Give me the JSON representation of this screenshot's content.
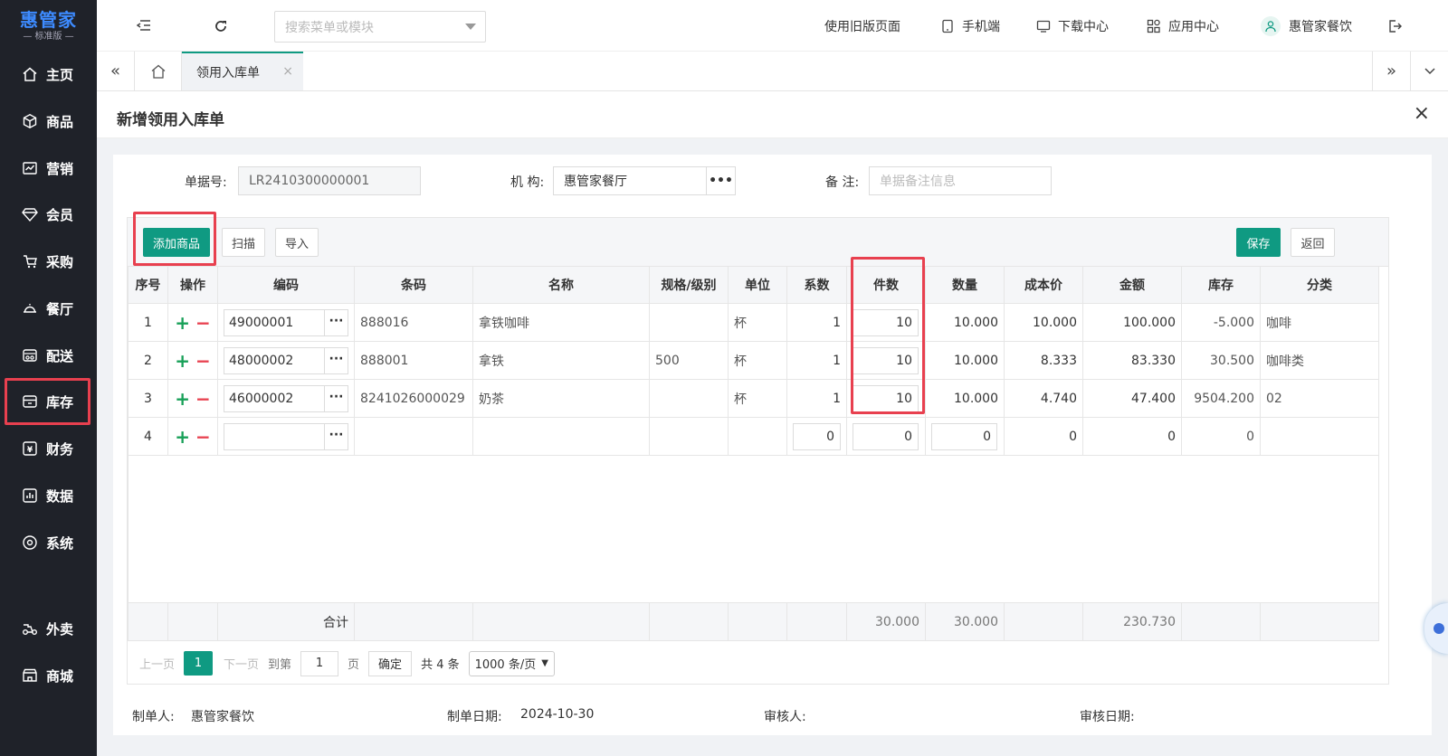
{
  "brand": {
    "title": "惠管家",
    "subtitle": "— 标准版 —"
  },
  "nav": [
    {
      "label": "主页",
      "icon": "home-icon"
    },
    {
      "label": "商品",
      "icon": "box-icon"
    },
    {
      "label": "营销",
      "icon": "chart-icon"
    },
    {
      "label": "会员",
      "icon": "diamond-icon"
    },
    {
      "label": "采购",
      "icon": "purchase-icon"
    },
    {
      "label": "餐厅",
      "icon": "cloche-icon"
    },
    {
      "label": "配送",
      "icon": "truck-icon"
    },
    {
      "label": "库存",
      "icon": "inventory-icon"
    },
    {
      "label": "财务",
      "icon": "finance-icon"
    },
    {
      "label": "数据",
      "icon": "data-icon"
    },
    {
      "label": "系统",
      "icon": "settings-icon"
    },
    {
      "label": "外卖",
      "icon": "delivery-icon"
    },
    {
      "label": "商城",
      "icon": "shop-icon"
    }
  ],
  "top": {
    "search_placeholder": "搜索菜单或模块",
    "old_page": "使用旧版页面",
    "mobile": "手机端",
    "download": "下载中心",
    "apps": "应用中心",
    "user": "惠管家餐饮"
  },
  "tabs": {
    "active": "领用入库单"
  },
  "page": {
    "title": "新增领用入库单"
  },
  "form": {
    "doc_no_label": "单据号:",
    "doc_no": "LR2410300000001",
    "org_label": "机 构:",
    "org": "惠管家餐厅",
    "remark_label": "备 注:",
    "remark_placeholder": "单据备注信息"
  },
  "toolbar": {
    "add": "添加商品",
    "scan": "扫描",
    "import": "导入",
    "save": "保存",
    "back": "返回"
  },
  "table": {
    "headers": [
      "序号",
      "操作",
      "编码",
      "条码",
      "名称",
      "规格/级别",
      "单位",
      "系数",
      "件数",
      "数量",
      "成本价",
      "金额",
      "库存",
      "分类"
    ],
    "rows": [
      {
        "no": "1",
        "code": "49000001",
        "barcode": "888016",
        "name": "拿铁咖啡",
        "spec": "",
        "unit": "杯",
        "factor": "1",
        "pieces": "10",
        "qty": "10.000",
        "cost": "10.000",
        "amount": "100.000",
        "stock": "-5.000",
        "category": "咖啡"
      },
      {
        "no": "2",
        "code": "48000002",
        "barcode": "888001",
        "name": "拿铁",
        "spec": "500",
        "unit": "杯",
        "factor": "1",
        "pieces": "10",
        "qty": "10.000",
        "cost": "8.333",
        "amount": "83.330",
        "stock": "30.500",
        "category": "咖啡类"
      },
      {
        "no": "3",
        "code": "46000002",
        "barcode": "8241026000029",
        "name": "奶茶",
        "spec": "",
        "unit": "杯",
        "factor": "1",
        "pieces": "10",
        "qty": "10.000",
        "cost": "4.740",
        "amount": "47.400",
        "stock": "9504.200",
        "category": "02"
      },
      {
        "no": "4",
        "code": "",
        "barcode": "",
        "name": "",
        "spec": "",
        "unit": "",
        "factor": "0",
        "pieces": "0",
        "qty": "0",
        "cost": "0",
        "amount": "0",
        "stock": "0",
        "category": ""
      }
    ],
    "total_label": "合计",
    "total_pieces": "30.000",
    "total_qty": "30.000",
    "total_amount": "230.730"
  },
  "pager": {
    "prev": "上一页",
    "current": "1",
    "next": "下一页",
    "goto": "到第",
    "page_input": "1",
    "page_unit": "页",
    "confirm": "确定",
    "total": "共 4 条",
    "page_size": "1000 条/页"
  },
  "footer": {
    "maker_label": "制单人:",
    "maker": "惠管家餐饮",
    "date_label": "制单日期:",
    "date": "2024-10-30",
    "auditor_label": "审核人:",
    "audit_date_label": "审核日期:"
  },
  "colors": {
    "sidebar": "#1f2229",
    "primary": "#0f9a82",
    "highlight": "#e8404f",
    "brand": "#3d8bff"
  }
}
